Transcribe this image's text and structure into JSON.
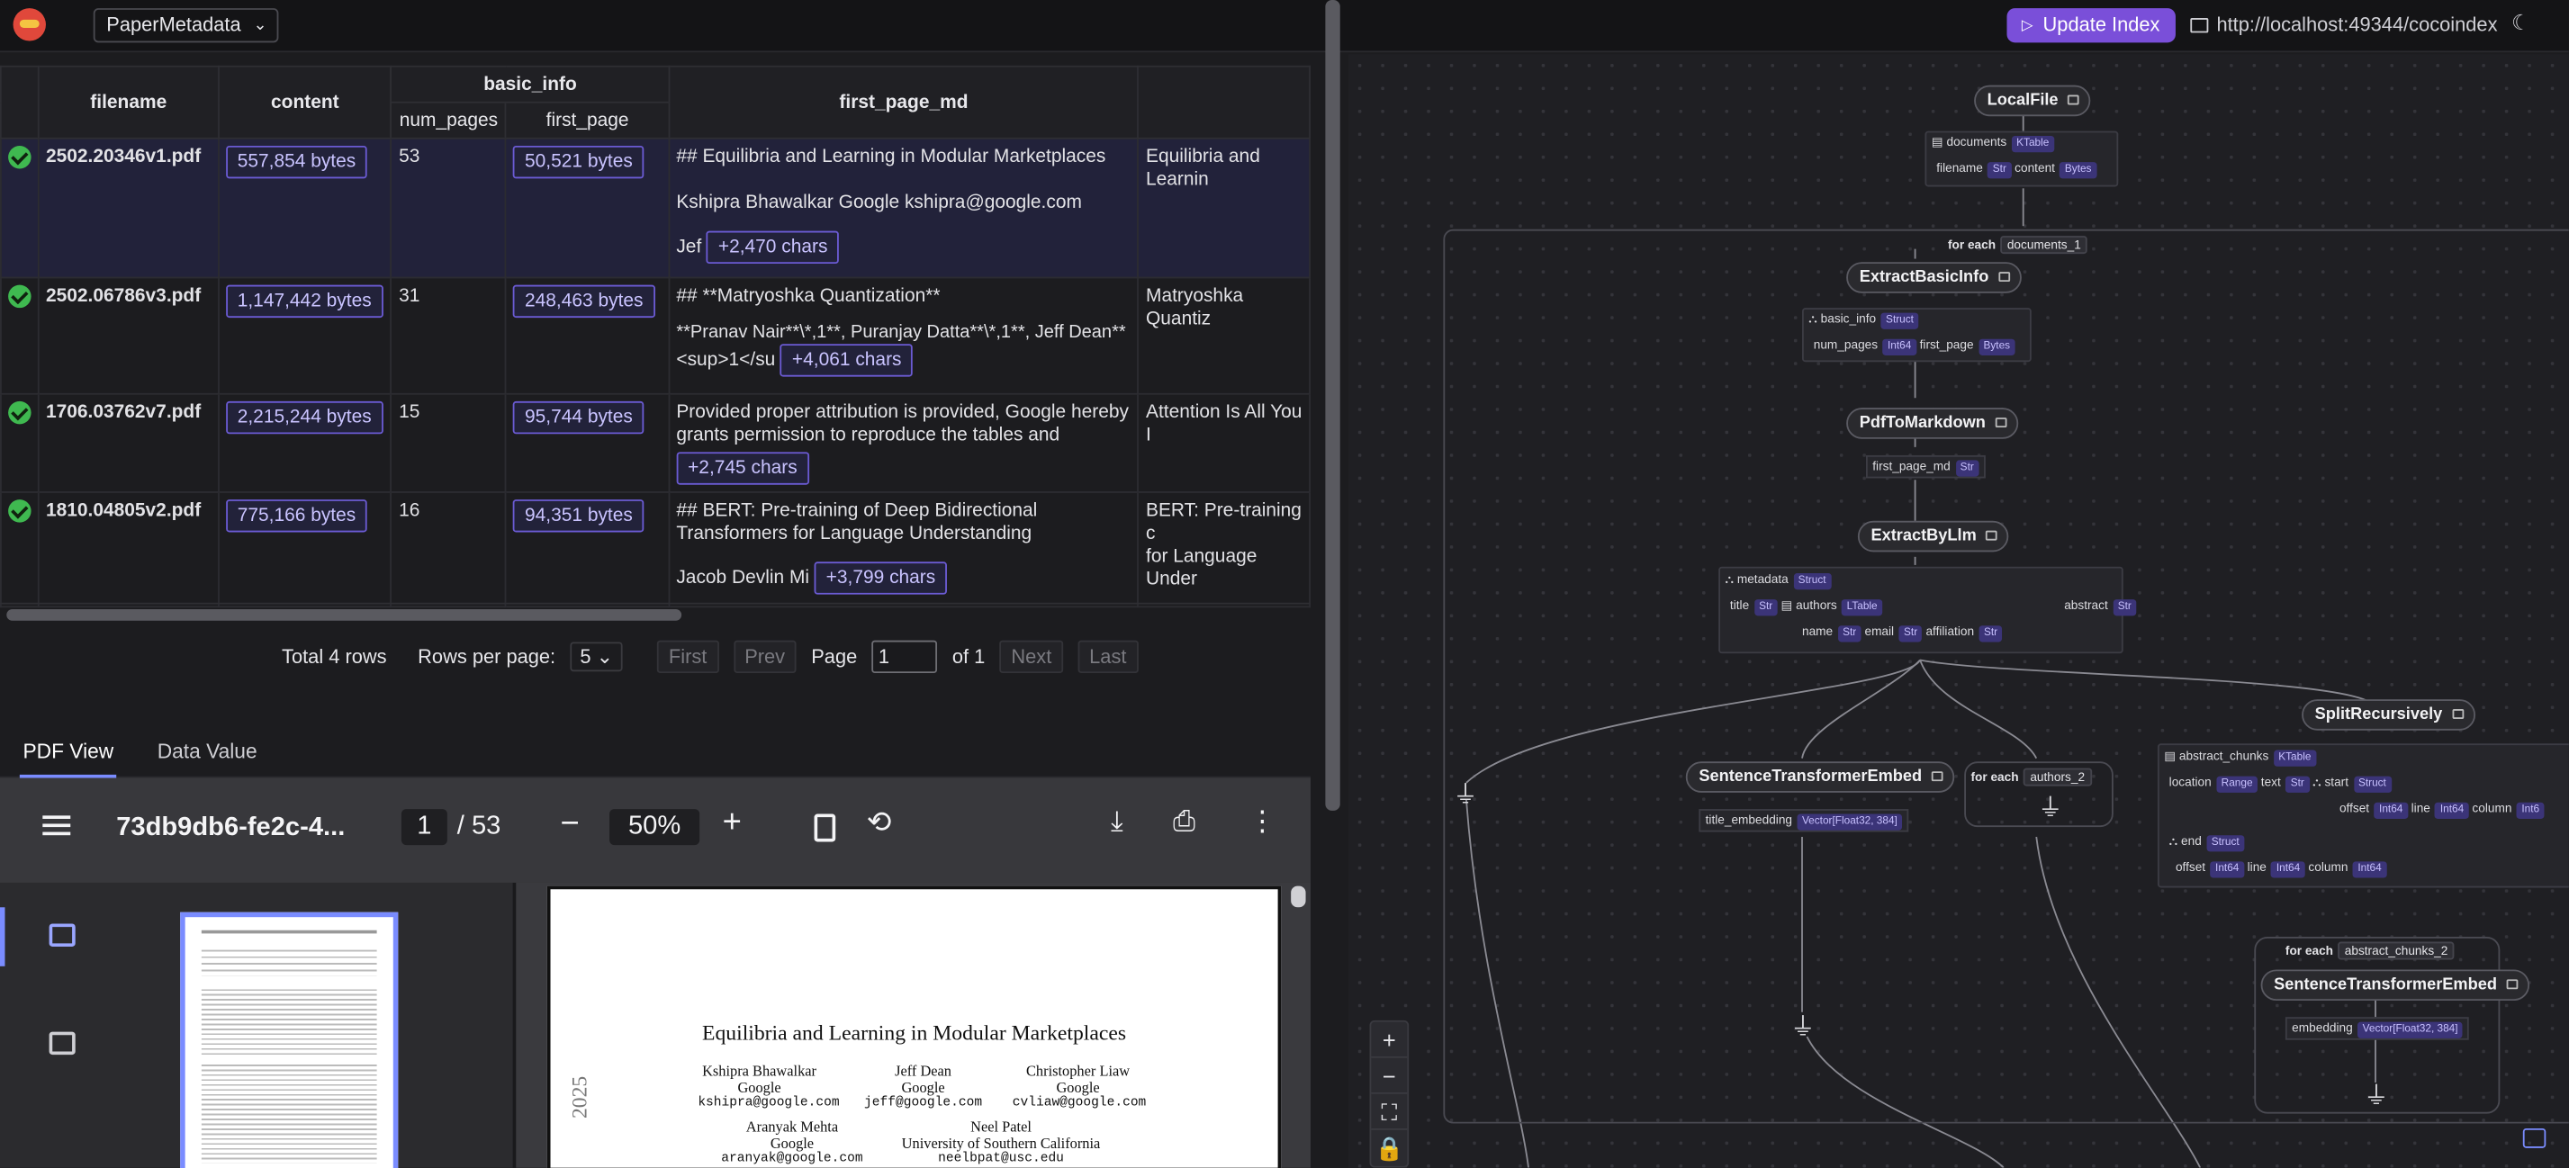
{
  "header": {
    "flow_name": "PaperMetadata",
    "update_label": "Update Index",
    "url": "http://localhost:49344/cocoindex"
  },
  "table": {
    "columns": {
      "filename": "filename",
      "content": "content",
      "basic_info": "basic_info",
      "num_pages": "num_pages",
      "first_page": "first_page",
      "first_page_md": "first_page_md"
    },
    "rows": [
      {
        "filename": "2502.20346v1.pdf",
        "content": "557,854 bytes",
        "num_pages": "53",
        "first_page": "50,521 bytes",
        "md_lines": [
          "## Equilibria and Learning in Modular Marketplaces",
          "Kshipra Bhawalkar Google kshipra@google.com",
          "Jef"
        ],
        "md_more": "+2,470 chars",
        "next_col": "Equilibria and Learnin"
      },
      {
        "filename": "2502.06786v3.pdf",
        "content": "1,147,442 bytes",
        "num_pages": "31",
        "first_page": "248,463 bytes",
        "md_lines": [
          "## **Matryoshka Quantization**",
          "**Pranav Nair**\\*,1**, Puranjay Datta**\\*,1**, Jeff Dean**",
          "<sup>1</su"
        ],
        "md_more": "+4,061 chars",
        "next_col": "Matryoshka Quantiz"
      },
      {
        "filename": "1706.03762v7.pdf",
        "content": "2,215,244 bytes",
        "num_pages": "15",
        "first_page": "95,744 bytes",
        "md_lines": [
          "Provided proper attribution is provided, Google hereby",
          "grants permission to reproduce the tables and"
        ],
        "md_more": "+2,745 chars",
        "next_col": "Attention Is All You I"
      },
      {
        "filename": "1810.04805v2.pdf",
        "content": "775,166 bytes",
        "num_pages": "16",
        "first_page": "94,351 bytes",
        "md_lines": [
          "## BERT: Pre-training of Deep Bidirectional",
          "Transformers for Language Understanding",
          "Jacob Devlin Mi"
        ],
        "md_more": "+3,799 chars",
        "next_col": [
          "BERT: Pre-training c",
          "for Language Under"
        ]
      }
    ]
  },
  "pager": {
    "total": "Total 4 rows",
    "rows_per_page_label": "Rows per page:",
    "rows_per_page": "5",
    "first": "First",
    "prev": "Prev",
    "page_label": "Page",
    "page": "1",
    "of": "of 1",
    "next": "Next",
    "last": "Last"
  },
  "tabs": {
    "pdf_view": "PDF View",
    "data_value": "Data Value"
  },
  "pdf": {
    "file_name": "73db9db6-fe2c-4...",
    "page": "1",
    "total": "/ 53",
    "zoom": "50%",
    "title": "Equilibria and Learning in Modular Marketplaces",
    "authors": [
      {
        "name": "Kshipra Bhawalkar",
        "org": "Google",
        "email": "kshipra@google.com"
      },
      {
        "name": "Jeff Dean",
        "org": "Google",
        "email": "jeff@google.com"
      },
      {
        "name": "Christopher Liaw",
        "org": "Google",
        "email": "cvliaw@google.com"
      },
      {
        "name": "Aranyak Mehta",
        "org": "Google",
        "email": "aranyak@google.com"
      },
      {
        "name": "Neel Patel",
        "org": "University of Southern California",
        "email": "neelbpat@usc.edu"
      }
    ],
    "year_margin": "2025"
  },
  "graph": {
    "nodes": {
      "local_file": "LocalFile",
      "extract_basic": "ExtractBasicInfo",
      "pdf_to_md": "PdfToMarkdown",
      "extract_llm": "ExtractByLlm",
      "split": "SplitRecursively",
      "ste1": "SentenceTransformerEmbed",
      "ste2": "SentenceTransformerEmbed"
    },
    "for_each": "for each",
    "scopes": {
      "documents": "documents_1",
      "authors": "authors_2",
      "chunks": "abstract_chunks_2"
    },
    "fields": {
      "documents": "documents",
      "ktable": "KTable",
      "filename": "filename",
      "str": "Str",
      "content": "content",
      "bytes": "Bytes",
      "basic_info": "basic_info",
      "struct": "Struct",
      "num_pages": "num_pages",
      "int64": "Int64",
      "first_page": "first_page",
      "first_page_md": "first_page_md",
      "metadata": "metadata",
      "title": "title",
      "authors": "authors",
      "ltable": "LTable",
      "abstract": "abstract",
      "name": "name",
      "email": "email",
      "affiliation": "affiliation",
      "title_embedding": "title_embedding",
      "vector": "Vector[Float32, 384]",
      "abstract_chunks": "abstract_chunks",
      "location": "location",
      "range": "Range",
      "text": "text",
      "start": "start",
      "offset": "offset",
      "line": "line",
      "column": "column",
      "int6": "Int6",
      "end": "end",
      "embedding": "embedding"
    }
  }
}
